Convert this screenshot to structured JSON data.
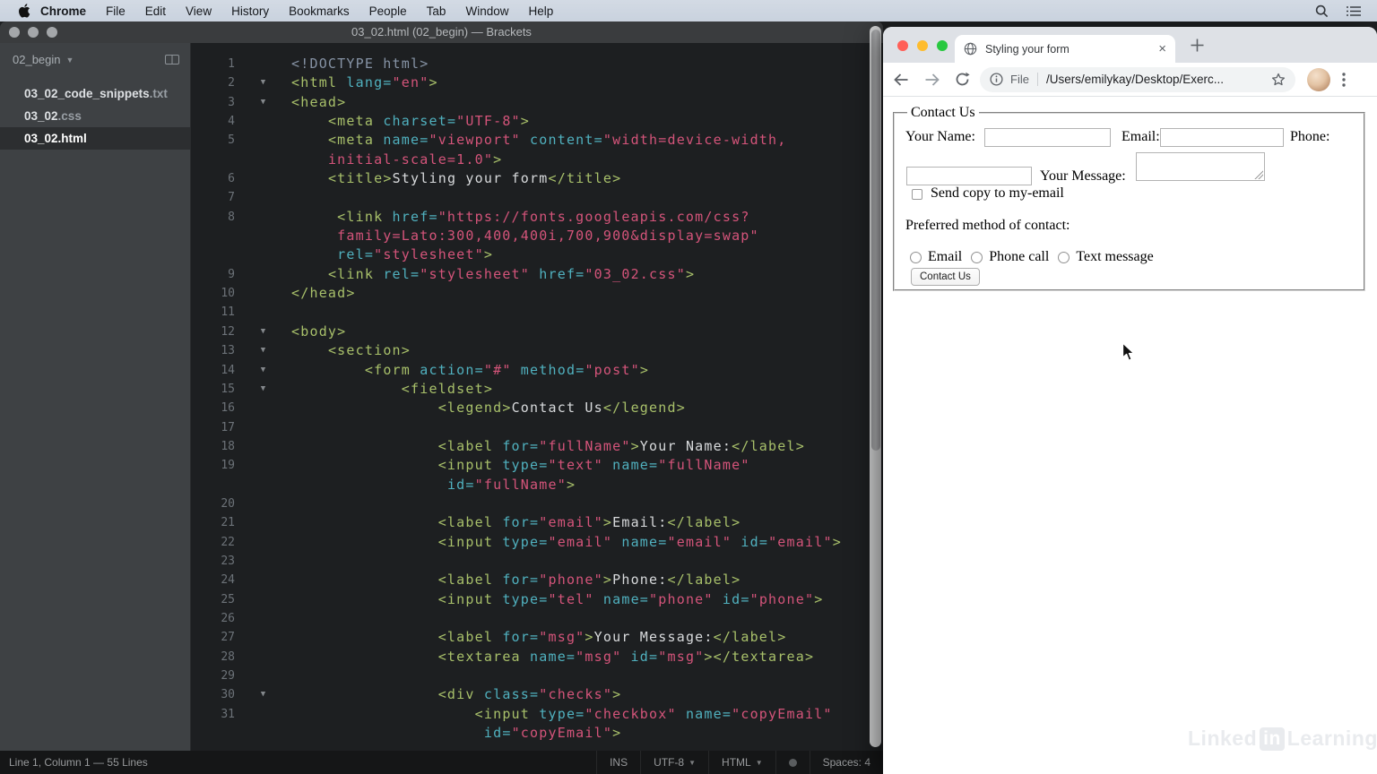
{
  "menubar": {
    "items": [
      {
        "label": "Chrome",
        "bold": true
      },
      {
        "label": "File"
      },
      {
        "label": "Edit"
      },
      {
        "label": "View"
      },
      {
        "label": "History"
      },
      {
        "label": "Bookmarks"
      },
      {
        "label": "People"
      },
      {
        "label": "Tab"
      },
      {
        "label": "Window"
      },
      {
        "label": "Help"
      }
    ],
    "right_icons": [
      "spotlight-search",
      "menu-list"
    ]
  },
  "brackets": {
    "window_title": "03_02.html (02_begin) — Brackets",
    "sidebar": {
      "project": "02_begin",
      "files": [
        {
          "base": "03_02_code_snippets",
          "ext": ".txt",
          "selected": false
        },
        {
          "base": "03_02",
          "ext": ".css",
          "selected": false
        },
        {
          "base": "03_02.html",
          "ext": "",
          "selected": true
        }
      ]
    },
    "statusbar": {
      "left": "Line 1, Column 1 — 55 Lines",
      "right_items": [
        {
          "label": "INS"
        },
        {
          "label": "UTF-8",
          "caret": true
        },
        {
          "label": "HTML",
          "caret": true
        },
        {
          "icon": "health-dot"
        },
        {
          "label": "Spaces: 4"
        }
      ]
    },
    "code": {
      "rows": [
        {
          "n": "1",
          "s": [
            [
              "m",
              "<!DOCTYPE html>"
            ]
          ]
        },
        {
          "n": "2",
          "f": 1,
          "s": [
            [
              "t",
              "<html"
            ],
            [
              "a",
              " lang="
            ],
            [
              "s",
              "\"en\""
            ],
            [
              "t",
              ">"
            ]
          ]
        },
        {
          "n": "3",
          "f": 1,
          "s": [
            [
              "t",
              "<head>"
            ]
          ]
        },
        {
          "n": "4",
          "i": 4,
          "s": [
            [
              "t",
              "<meta"
            ],
            [
              "a",
              " charset="
            ],
            [
              "s",
              "\"UTF-8\""
            ],
            [
              "t",
              ">"
            ]
          ]
        },
        {
          "n": "5",
          "i": 4,
          "s": [
            [
              "t",
              "<meta"
            ],
            [
              "a",
              " name="
            ],
            [
              "s",
              "\"viewport\""
            ],
            [
              "a",
              " content="
            ],
            [
              "s",
              "\"width=device-width,"
            ]
          ]
        },
        {
          "i": 4,
          "s": [
            [
              "s",
              "initial-scale=1.0\""
            ],
            [
              "t",
              ">"
            ]
          ]
        },
        {
          "n": "6",
          "i": 4,
          "s": [
            [
              "t",
              "<title>"
            ],
            [
              "p",
              "Styling your form"
            ],
            [
              "t",
              "</title>"
            ]
          ]
        },
        {
          "n": "7",
          "s": []
        },
        {
          "n": "8",
          "i": 5,
          "s": [
            [
              "t",
              "<link"
            ],
            [
              "a",
              " href="
            ],
            [
              "s",
              "\"https://fonts.googleapis.com/css?"
            ]
          ]
        },
        {
          "i": 5,
          "s": [
            [
              "s",
              "family=Lato:300,400,400i,700,900&display=swap\""
            ]
          ]
        },
        {
          "i": 5,
          "s": [
            [
              "a",
              "rel="
            ],
            [
              "s",
              "\"stylesheet\""
            ],
            [
              "t",
              ">"
            ]
          ]
        },
        {
          "n": "9",
          "i": 4,
          "s": [
            [
              "t",
              "<link"
            ],
            [
              "a",
              " rel="
            ],
            [
              "s",
              "\"stylesheet\""
            ],
            [
              "a",
              " href="
            ],
            [
              "s",
              "\"03_02.css\""
            ],
            [
              "t",
              ">"
            ]
          ]
        },
        {
          "n": "10",
          "s": [
            [
              "t",
              "</head>"
            ]
          ]
        },
        {
          "n": "11",
          "s": []
        },
        {
          "n": "12",
          "f": 1,
          "s": [
            [
              "t",
              "<body>"
            ]
          ]
        },
        {
          "n": "13",
          "f": 1,
          "i": 4,
          "s": [
            [
              "t",
              "<section>"
            ]
          ]
        },
        {
          "n": "14",
          "f": 1,
          "i": 8,
          "s": [
            [
              "t",
              "<form"
            ],
            [
              "a",
              " action="
            ],
            [
              "s",
              "\"#\""
            ],
            [
              "a",
              " method="
            ],
            [
              "s",
              "\"post\""
            ],
            [
              "t",
              ">"
            ]
          ]
        },
        {
          "n": "15",
          "f": 1,
          "i": 12,
          "s": [
            [
              "t",
              "<fieldset>"
            ]
          ]
        },
        {
          "n": "16",
          "i": 16,
          "s": [
            [
              "t",
              "<legend>"
            ],
            [
              "p",
              "Contact Us"
            ],
            [
              "t",
              "</legend>"
            ]
          ]
        },
        {
          "n": "17",
          "s": []
        },
        {
          "n": "18",
          "i": 16,
          "s": [
            [
              "t",
              "<label"
            ],
            [
              "a",
              " for="
            ],
            [
              "s",
              "\"fullName\""
            ],
            [
              "t",
              ">"
            ],
            [
              "p",
              "Your Name:"
            ],
            [
              "t",
              "</label>"
            ]
          ]
        },
        {
          "n": "19",
          "i": 16,
          "s": [
            [
              "t",
              "<input"
            ],
            [
              "a",
              " type="
            ],
            [
              "s",
              "\"text\""
            ],
            [
              "a",
              " name="
            ],
            [
              "s",
              "\"fullName\""
            ]
          ]
        },
        {
          "i": 17,
          "s": [
            [
              "a",
              "id="
            ],
            [
              "s",
              "\"fullName\""
            ],
            [
              "t",
              ">"
            ]
          ]
        },
        {
          "n": "20",
          "s": []
        },
        {
          "n": "21",
          "i": 16,
          "s": [
            [
              "t",
              "<label"
            ],
            [
              "a",
              " for="
            ],
            [
              "s",
              "\"email\""
            ],
            [
              "t",
              ">"
            ],
            [
              "p",
              "Email:"
            ],
            [
              "t",
              "</label>"
            ]
          ]
        },
        {
          "n": "22",
          "i": 16,
          "s": [
            [
              "t",
              "<input"
            ],
            [
              "a",
              " type="
            ],
            [
              "s",
              "\"email\""
            ],
            [
              "a",
              " name="
            ],
            [
              "s",
              "\"email\""
            ],
            [
              "a",
              " id="
            ],
            [
              "s",
              "\"email\""
            ],
            [
              "t",
              ">"
            ]
          ]
        },
        {
          "n": "23",
          "s": []
        },
        {
          "n": "24",
          "i": 16,
          "s": [
            [
              "t",
              "<label"
            ],
            [
              "a",
              " for="
            ],
            [
              "s",
              "\"phone\""
            ],
            [
              "t",
              ">"
            ],
            [
              "p",
              "Phone:"
            ],
            [
              "t",
              "</label>"
            ]
          ]
        },
        {
          "n": "25",
          "i": 16,
          "s": [
            [
              "t",
              "<input"
            ],
            [
              "a",
              " type="
            ],
            [
              "s",
              "\"tel\""
            ],
            [
              "a",
              " name="
            ],
            [
              "s",
              "\"phone\""
            ],
            [
              "a",
              " id="
            ],
            [
              "s",
              "\"phone\""
            ],
            [
              "t",
              ">"
            ]
          ]
        },
        {
          "n": "26",
          "s": []
        },
        {
          "n": "27",
          "i": 16,
          "s": [
            [
              "t",
              "<label"
            ],
            [
              "a",
              " for="
            ],
            [
              "s",
              "\"msg\""
            ],
            [
              "t",
              ">"
            ],
            [
              "p",
              "Your Message:"
            ],
            [
              "t",
              "</label>"
            ]
          ]
        },
        {
          "n": "28",
          "i": 16,
          "s": [
            [
              "t",
              "<textarea"
            ],
            [
              "a",
              " name="
            ],
            [
              "s",
              "\"msg\""
            ],
            [
              "a",
              " id="
            ],
            [
              "s",
              "\"msg\""
            ],
            [
              "t",
              ">"
            ],
            [
              "t",
              "</textarea>"
            ]
          ]
        },
        {
          "n": "29",
          "s": []
        },
        {
          "n": "30",
          "f": 1,
          "i": 16,
          "s": [
            [
              "t",
              "<div"
            ],
            [
              "a",
              " class="
            ],
            [
              "s",
              "\"checks\""
            ],
            [
              "t",
              ">"
            ]
          ]
        },
        {
          "n": "31",
          "i": 20,
          "s": [
            [
              "t",
              "<input"
            ],
            [
              "a",
              " type="
            ],
            [
              "s",
              "\"checkbox\""
            ],
            [
              "a",
              " name="
            ],
            [
              "s",
              "\"copyEmail\""
            ]
          ]
        },
        {
          "i": 21,
          "s": [
            [
              "a",
              "id="
            ],
            [
              "s",
              "\"copyEmail\""
            ],
            [
              "t",
              ">"
            ]
          ]
        }
      ]
    }
  },
  "chrome": {
    "tab_title": "Styling your form",
    "url": {
      "scheme_label": "File",
      "path": "/Users/emilykay/Desktop/Exerc..."
    },
    "page": {
      "form": {
        "legend": "Contact Us",
        "name_label": "Your Name:",
        "email_label": "Email:",
        "phone_label": "Phone:",
        "message_label": "Your Message:",
        "checkbox_label": "Send copy to my-email",
        "preferred_heading": "Preferred method of contact:",
        "radio_options": [
          "Email",
          "Phone call",
          "Text message"
        ],
        "submit_label": "Contact Us"
      }
    },
    "watermark": {
      "linked": "Linked",
      "in": "in",
      "learning": "Learning"
    }
  },
  "colors": {
    "traffic_red": "#ff5f57",
    "traffic_yellow": "#febc2e",
    "traffic_green": "#28c840",
    "code_background": "#1d1f21",
    "syntax_tag": "#a8c06a",
    "syntax_attr": "#50b1bf",
    "syntax_string": "#d4547a",
    "syntax_text": "#d8dadc",
    "syntax_meta": "#8693a5"
  }
}
